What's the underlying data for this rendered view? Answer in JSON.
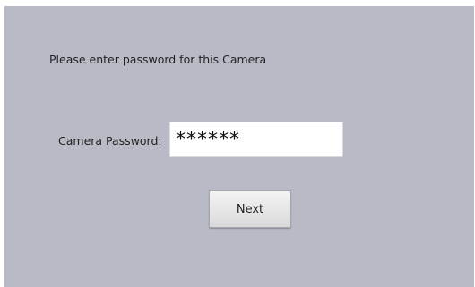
{
  "dialog": {
    "prompt": "Please enter password for this Camera",
    "password_label": "Camera Password:",
    "password_value": "******",
    "next_label": "Next"
  },
  "colors": {
    "panel_background": "#b8bbc6",
    "input_background": "#ffffff",
    "button_background": "#e6e6e6"
  }
}
